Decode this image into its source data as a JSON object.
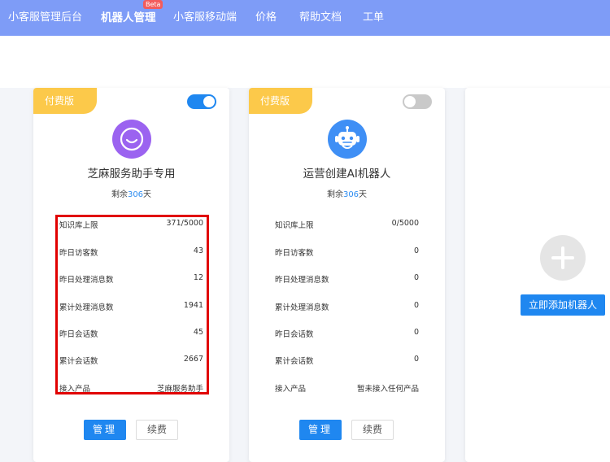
{
  "nav": {
    "items": [
      {
        "label": "小客服管理后台"
      },
      {
        "label": "机器人管理"
      },
      {
        "label": "小客服移动端"
      },
      {
        "label": "价格"
      },
      {
        "label": "帮助文档"
      },
      {
        "label": "工单"
      }
    ],
    "beta_badge": "Beta"
  },
  "cards": [
    {
      "ribbon": "付费版",
      "toggle_on": true,
      "name": "芝麻服务助手专用",
      "remain_prefix": "剩余",
      "remain_days": "306",
      "remain_suffix": "天",
      "stats": [
        {
          "label": "知识库上限",
          "value": "371/5000"
        },
        {
          "label": "昨日访客数",
          "value": "43"
        },
        {
          "label": "昨日处理消息数",
          "value": "12"
        },
        {
          "label": "累计处理消息数",
          "value": "1941"
        },
        {
          "label": "昨日会话数",
          "value": "45"
        },
        {
          "label": "累计会话数",
          "value": "2667"
        },
        {
          "label": "接入产品",
          "value": "芝麻服务助手"
        }
      ],
      "manage_label": "管理",
      "renew_label": "续费"
    },
    {
      "ribbon": "付费版",
      "toggle_on": false,
      "name": "运营创建AI机器人",
      "remain_prefix": "剩余",
      "remain_days": "306",
      "remain_suffix": "天",
      "stats": [
        {
          "label": "知识库上限",
          "value": "0/5000"
        },
        {
          "label": "昨日访客数",
          "value": "0"
        },
        {
          "label": "昨日处理消息数",
          "value": "0"
        },
        {
          "label": "累计处理消息数",
          "value": "0"
        },
        {
          "label": "昨日会话数",
          "value": "0"
        },
        {
          "label": "累计会话数",
          "value": "0"
        },
        {
          "label": "接入产品",
          "value": "暂未接入任何产品"
        }
      ],
      "manage_label": "管理",
      "renew_label": "续费"
    }
  ],
  "add_card": {
    "button_label": "立即添加机器人",
    "icon": "plus-icon"
  },
  "colors": {
    "nav_bg": "#7e9cf7",
    "primary": "#1f87f0",
    "ribbon": "#fcc94a",
    "highlight": "#e10000"
  },
  "icons": {
    "avatar_1": "smile-face-icon",
    "avatar_2": "robot-icon"
  }
}
